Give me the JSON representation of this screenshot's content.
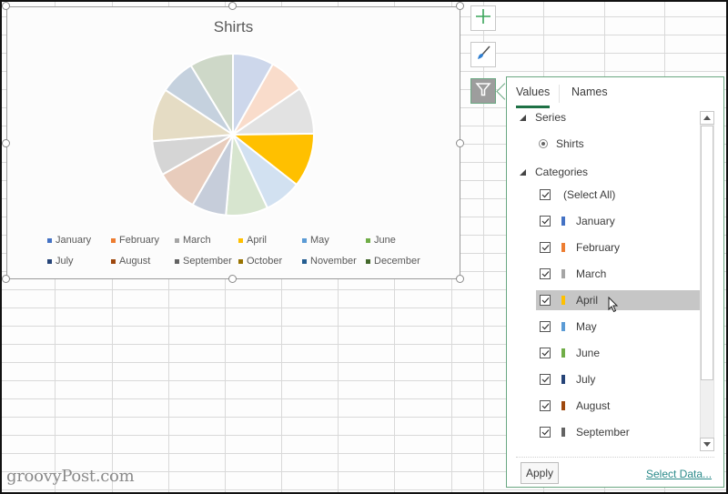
{
  "chart_data": {
    "type": "pie",
    "title": "Shirts",
    "series_name": "Shirts",
    "categories": [
      "January",
      "February",
      "March",
      "April",
      "May",
      "June",
      "July",
      "August",
      "September",
      "October",
      "November",
      "December"
    ],
    "values_percent": [
      8.2,
      7.2,
      9.4,
      10.8,
      7.4,
      8.4,
      6.9,
      8.5,
      6.9,
      10.6,
      7.0,
      8.7
    ],
    "highlighted_category": "April",
    "colors": [
      "#4472c4",
      "#ed7d31",
      "#a5a5a5",
      "#ffc000",
      "#5b9bd5",
      "#70ad47",
      "#264478",
      "#9e480e",
      "#636363",
      "#997300",
      "#255e91",
      "#43682b"
    ],
    "faded_colors": [
      "#cdd7eb",
      "#f9dccb",
      "#e2e2e2",
      "#ffc000",
      "#d2e1f1",
      "#d7e5cf",
      "#c6cdda",
      "#e8ccbc",
      "#d5d5d5",
      "#e5dcc4",
      "#c5d1de",
      "#ced8c8"
    ],
    "legend": {
      "position": "bottom",
      "entries": [
        "January",
        "February",
        "March",
        "April",
        "May",
        "June",
        "July",
        "August",
        "September",
        "October",
        "November",
        "December"
      ]
    }
  },
  "side_buttons": [
    {
      "name": "chart-elements",
      "icon": "plus-icon"
    },
    {
      "name": "chart-styles",
      "icon": "brush-icon"
    },
    {
      "name": "chart-filters",
      "icon": "filter-icon",
      "active": true
    }
  ],
  "filter_panel": {
    "tabs": [
      {
        "label": "Values",
        "active": true
      },
      {
        "label": "Names",
        "active": false
      }
    ],
    "series_header": "Series",
    "series": [
      {
        "label": "Shirts",
        "selected": true
      }
    ],
    "categories_header": "Categories",
    "select_all_label": "(Select All)",
    "select_all_checked": true,
    "category_items": [
      {
        "label": "January",
        "checked": true,
        "color": "#4472c4"
      },
      {
        "label": "February",
        "checked": true,
        "color": "#ed7d31"
      },
      {
        "label": "March",
        "checked": true,
        "color": "#a5a5a5"
      },
      {
        "label": "April",
        "checked": true,
        "color": "#ffc000",
        "hovered": true
      },
      {
        "label": "May",
        "checked": true,
        "color": "#5b9bd5"
      },
      {
        "label": "June",
        "checked": true,
        "color": "#70ad47"
      },
      {
        "label": "July",
        "checked": true,
        "color": "#264478"
      },
      {
        "label": "August",
        "checked": true,
        "color": "#9e480e"
      },
      {
        "label": "September",
        "checked": true,
        "color": "#636363"
      }
    ],
    "apply_label": "Apply",
    "select_data_label": "Select Data..."
  },
  "watermark": "groovyPost.com"
}
